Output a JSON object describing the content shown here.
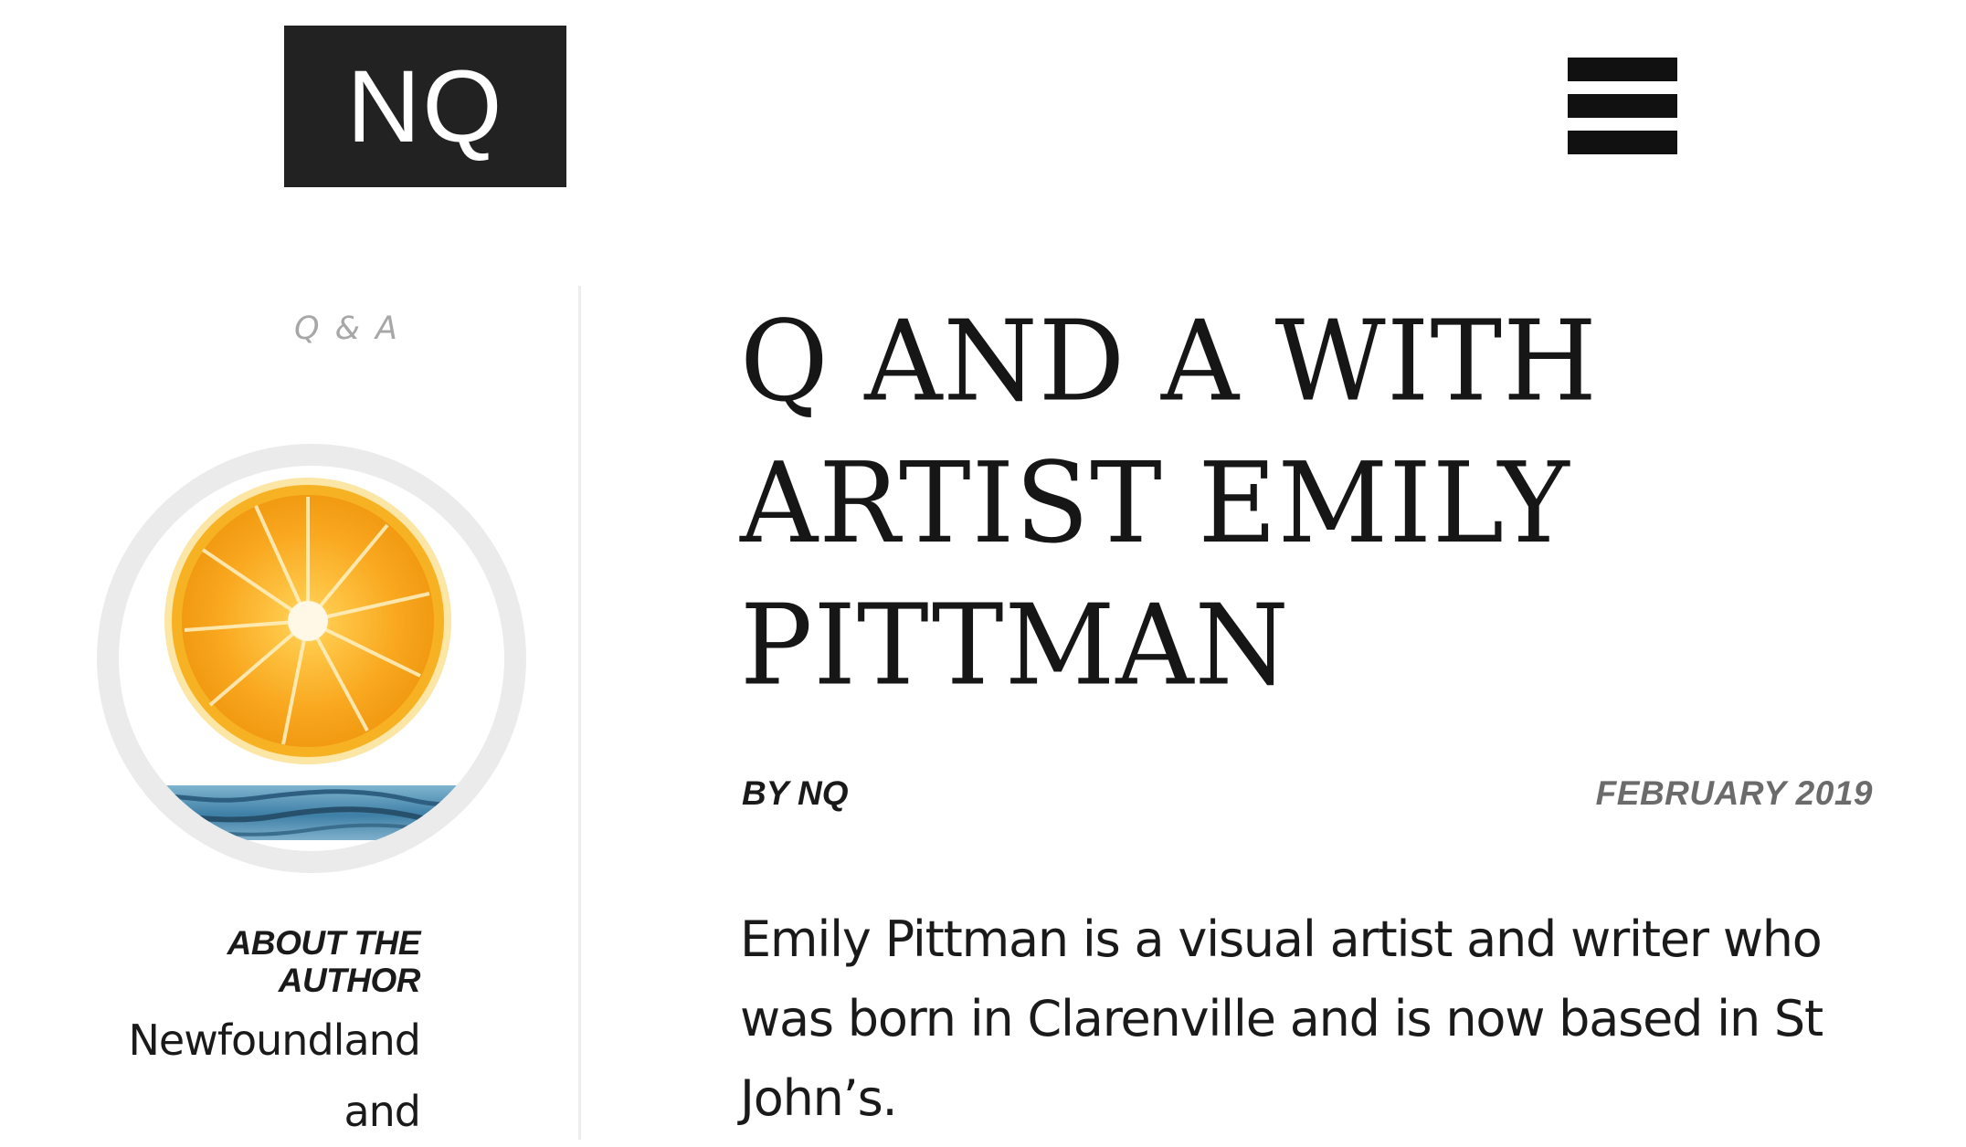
{
  "header": {
    "logo_text": "NQ",
    "menu_icon": "hamburger-menu-icon"
  },
  "sidebar": {
    "category": "Q & A",
    "author_photo": "orange-slice-over-water-image",
    "about_heading_line1": "ABOUT THE",
    "about_heading_line2": "AUTHOR",
    "about_body_line1": "Newfoundland",
    "about_body_line2": "and"
  },
  "article": {
    "title_line1": "Q AND A WITH",
    "title_line2": "ARTIST EMILY",
    "title_line3": "PITTMAN",
    "byline": "BY NQ",
    "date": "FEBRUARY 2019",
    "intro": "Emily Pittman is a visual artist and writer who was born in Clarenville and is now based in St John’s."
  },
  "colors": {
    "logo_bg": "#222222",
    "logo_text": "#ffffff",
    "category_text": "#a7a7a7",
    "date_text": "#6b6b6b",
    "divider": "#ededed",
    "photo_ring": "#ebebeb",
    "orange": "#f7a51c",
    "water": "#4f8fb3"
  }
}
